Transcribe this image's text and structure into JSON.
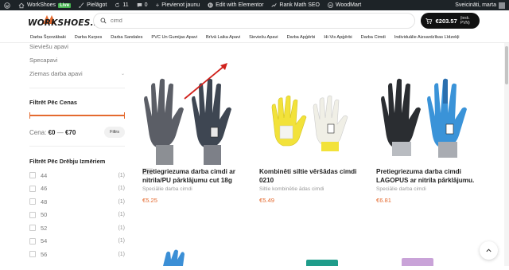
{
  "adminbar": {
    "site": "WorkShoes",
    "live": "Live",
    "customize": "Pielāgot",
    "comments_count": "11",
    "comments_other": "0",
    "new": "Pievienot jaunu",
    "elementor": "Edit with Elementor",
    "rankmath": "Rank Math SEO",
    "woodmart": "WoodMart",
    "greeting": "Sveicināti, marta"
  },
  "header": {
    "logo_text": "WORKSHOES.LV",
    "search_value": "cimd",
    "cart_total": "€203.57",
    "cart_vat": "(iesk. PVN)"
  },
  "nav": [
    "Darba Šņorzābaki",
    "Darba Kurpes",
    "Darba Sandales",
    "PVC Un Gumijas Apavi",
    "Brīvā Laika Apavi",
    "Sieviešu Apavi",
    "Darba Apģērbi",
    "Hi-Vis Apģērbi",
    "Darba Cimdi",
    "Individuālie Aizsardzības Līdzekļi"
  ],
  "sidebar": {
    "categories": [
      "Sieviešu apavi",
      "Specapavi",
      "Ziemas darba apavi"
    ],
    "price_title": "Filtrēt Pēc Cenas",
    "price_prefix": "Cena:",
    "price_min": "€0",
    "price_sep": "—",
    "price_max": "€70",
    "filter_button": "Filtrs",
    "size_title": "Filtrēt Pēc Drēbju Izmēriem",
    "sizes": [
      {
        "label": "44",
        "count": "(1)"
      },
      {
        "label": "46",
        "count": "(1)"
      },
      {
        "label": "48",
        "count": "(1)"
      },
      {
        "label": "50",
        "count": "(1)"
      },
      {
        "label": "52",
        "count": "(1)"
      },
      {
        "label": "54",
        "count": "(1)"
      },
      {
        "label": "56",
        "count": "(1)"
      }
    ]
  },
  "products": [
    {
      "name_hl": "Pre",
      "name": "tiegriezuma darba cimdi ar nitrila/PU pārklājumu cut 18g",
      "category": "Speciālie darba cimdi",
      "price": "€5.25"
    },
    {
      "name_hl": "",
      "name": "Kombinēti siltie vēršādas cimdi 0210",
      "category": "Siltie kombinētie ādas cimdi",
      "price": "€5.49"
    },
    {
      "name_hl": "",
      "name": "Pretiegriezuma darba cimdi LAGOPUS ar nitrila pārklājumu.",
      "category": "Speciālie darba cimdi",
      "price": "€6.81"
    }
  ],
  "colors": {
    "accent": "#e46a2f",
    "adminbar": "#1d2327",
    "arrow": "#d0211c"
  }
}
